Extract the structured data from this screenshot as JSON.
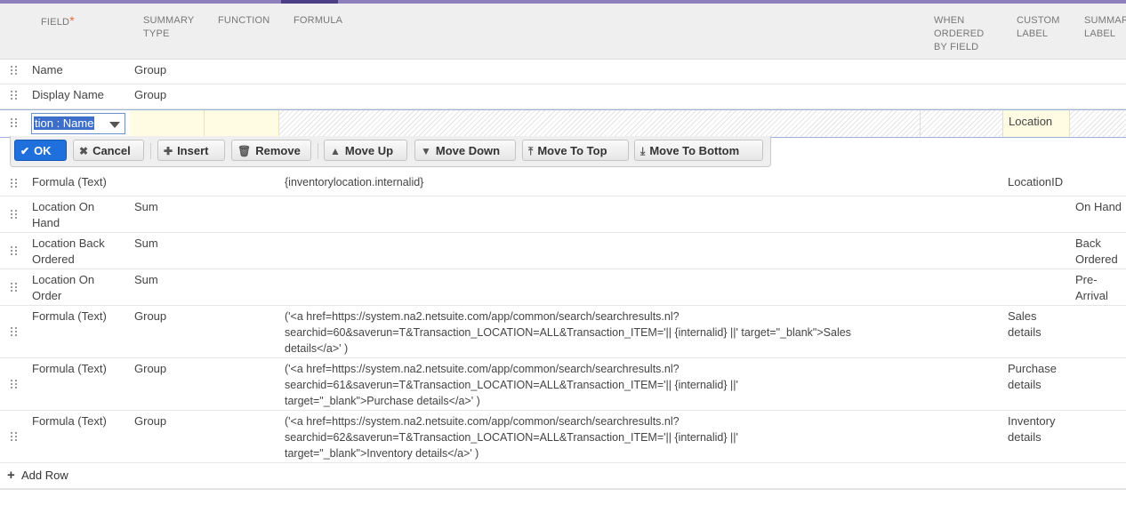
{
  "header": {
    "field": "FIELD",
    "required_mark": "*",
    "summary_type": "SUMMARY\nTYPE",
    "function": "FUNCTION",
    "formula": "FORMULA",
    "when_ordered": "WHEN\nORDERED\nBY FIELD",
    "custom_label": "CUSTOM\nLABEL",
    "summary_label": "SUMMARY\nLABEL"
  },
  "rows_top": [
    {
      "field": "Name",
      "summary_type": "Group"
    },
    {
      "field": "Display Name",
      "summary_type": "Group"
    }
  ],
  "edit_row": {
    "field_value": "tion : Name",
    "custom_label": "Location"
  },
  "toolbar": {
    "ok": "OK",
    "cancel": "Cancel",
    "insert": "Insert",
    "remove": "Remove",
    "move_up": "Move Up",
    "move_down": "Move Down",
    "move_to_top": "Move To Top",
    "move_to_bottom": "Move To Bottom"
  },
  "rows": [
    {
      "field": "Formula (Text)",
      "summary_type": "",
      "formula": "{inventorylocation.internalid}",
      "custom_label": "LocationID",
      "summary_label": ""
    },
    {
      "field": "Location On\nHand",
      "summary_type": "Sum",
      "formula": "",
      "custom_label": "",
      "summary_label": "On Hand"
    },
    {
      "field": "Location Back\nOrdered",
      "summary_type": "Sum",
      "formula": "",
      "custom_label": "",
      "summary_label": "Back\nOrdered"
    },
    {
      "field": "Location On\nOrder",
      "summary_type": "Sum",
      "formula": "",
      "custom_label": "",
      "summary_label": "Pre-Arrival"
    },
    {
      "field": "Formula (Text)",
      "summary_type": "Group",
      "formula": "('<a href=https://system.na2.netsuite.com/app/common/search/searchresults.nl?\nsearchid=60&saverun=T&Transaction_LOCATION=ALL&Transaction_ITEM='|| {internalid} ||' target=\"_blank\">Sales\ndetails</a>' )",
      "custom_label": "Sales\ndetails",
      "summary_label": ""
    },
    {
      "field": "Formula (Text)",
      "summary_type": "Group",
      "formula": "('<a href=https://system.na2.netsuite.com/app/common/search/searchresults.nl?\nsearchid=61&saverun=T&Transaction_LOCATION=ALL&Transaction_ITEM='|| {internalid} ||'\ntarget=\"_blank\">Purchase details</a>' )",
      "custom_label": "Purchase\ndetails",
      "summary_label": ""
    },
    {
      "field": "Formula (Text)",
      "summary_type": "Group",
      "formula": "('<a href=https://system.na2.netsuite.com/app/common/search/searchresults.nl?\nsearchid=62&saverun=T&Transaction_LOCATION=ALL&Transaction_ITEM='|| {internalid} ||'\ntarget=\"_blank\">Inventory details</a>' )",
      "custom_label": "Inventory\ndetails",
      "summary_label": ""
    }
  ],
  "add_row": {
    "icon": "plus-icon",
    "label": "Add Row"
  },
  "colors": {
    "accent": "#1f6fdc",
    "top_bar": "#8e7ebb",
    "edit_cell": "#fffce3"
  }
}
